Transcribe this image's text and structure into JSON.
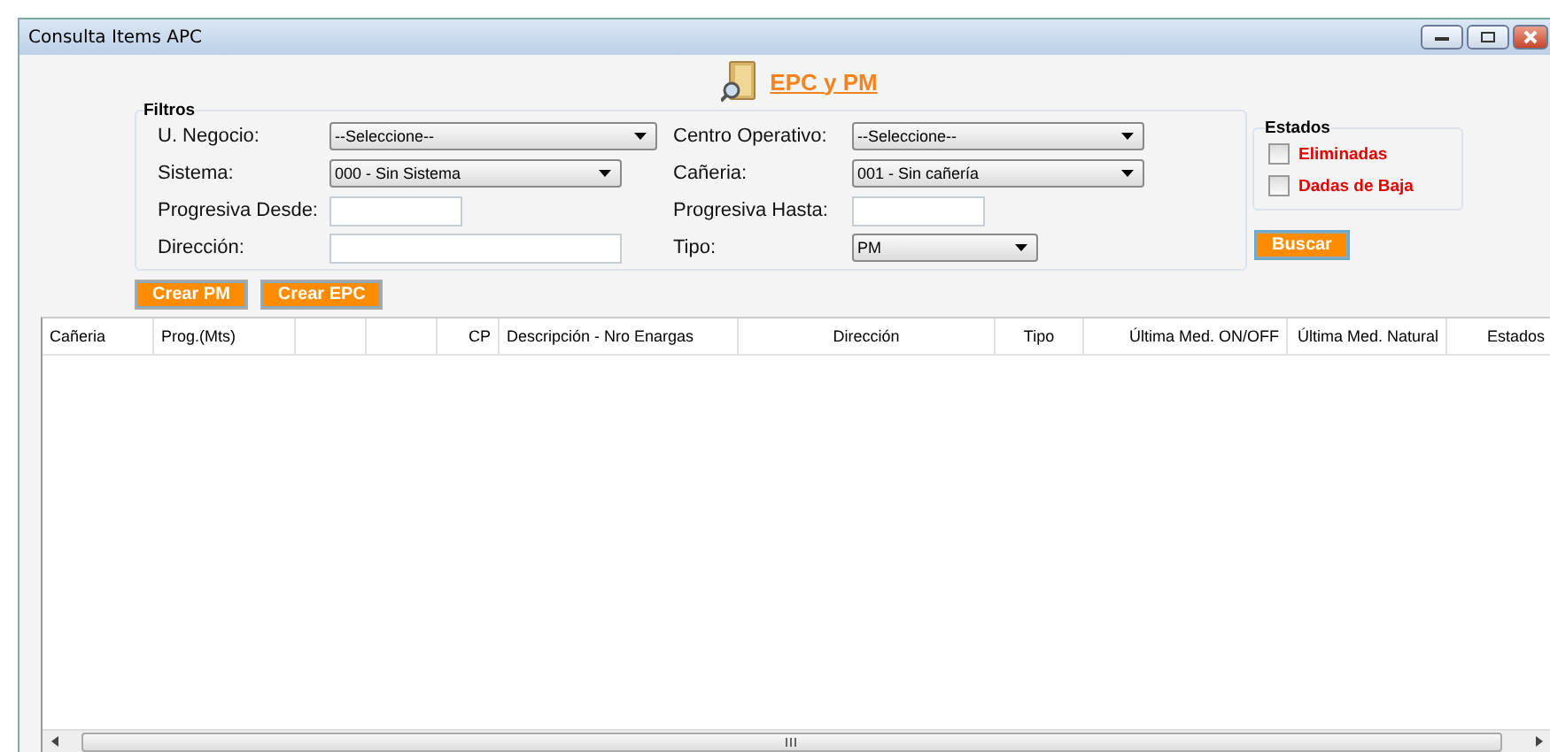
{
  "window": {
    "title": "Consulta Items APC"
  },
  "header": {
    "title": "EPC y PM"
  },
  "filters": {
    "title": "Filtros",
    "fields": [
      {
        "label": "U. Negocio:",
        "kind": "select",
        "value": "--Seleccione--"
      },
      {
        "label": "Centro Operativo:",
        "kind": "select",
        "value": "--Seleccione--"
      },
      {
        "label": "Sistema:",
        "kind": "select",
        "value": "000 - Sin Sistema"
      },
      {
        "label": "Cañeria:",
        "kind": "select",
        "value": "001 - Sin cañería"
      },
      {
        "label": "Progresiva Desde:",
        "kind": "text"
      },
      {
        "label": "Progresiva Hasta:",
        "kind": "text"
      },
      {
        "label": "Dirección:",
        "kind": "text"
      },
      {
        "label": "Tipo:",
        "kind": "select",
        "value": "PM"
      }
    ]
  },
  "estados": {
    "title": "Estados",
    "options": [
      {
        "label": "Eliminadas",
        "checked": false
      },
      {
        "label": "Dadas de Baja",
        "checked": false
      }
    ]
  },
  "buttons": {
    "search": "Buscar",
    "actions": [
      "Crear PM",
      "Crear EPC"
    ]
  },
  "table": {
    "columns": [
      {
        "kind": "label",
        "label": "Cañeria"
      },
      {
        "kind": "label",
        "label": "Prog.(Mts)"
      },
      {
        "kind": "blank"
      },
      {
        "kind": "blank"
      },
      {
        "kind": "label",
        "label": "CP"
      },
      {
        "kind": "label",
        "label": "Descripción - Nro Enargas"
      },
      {
        "kind": "label",
        "label": "Dirección"
      },
      {
        "kind": "label",
        "label": "Tipo"
      },
      {
        "kind": "label",
        "label": "Última Med. ON/OFF"
      },
      {
        "kind": "label",
        "label": "Última Med. Natural"
      },
      {
        "kind": "label",
        "label": "Estados"
      }
    ]
  }
}
